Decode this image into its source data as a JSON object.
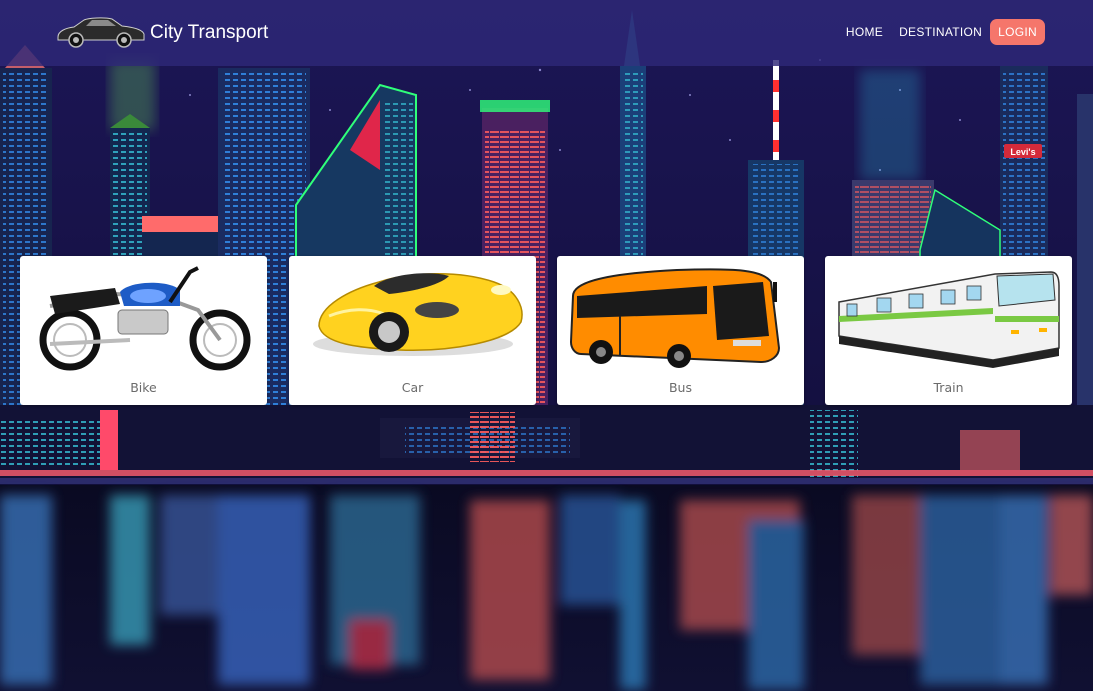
{
  "brand": {
    "title": "City Transport"
  },
  "nav": {
    "home": "HOME",
    "destination": "DESTINATION",
    "login": "LOGIN"
  },
  "cards": [
    {
      "label": "Bike"
    },
    {
      "label": "Car"
    },
    {
      "label": "Bus"
    },
    {
      "label": "Train"
    }
  ],
  "scene": {
    "sign": "Levi's"
  },
  "colors": {
    "accent": "#f5766b",
    "navbar": "#2e2878",
    "background": "#1a1250"
  }
}
